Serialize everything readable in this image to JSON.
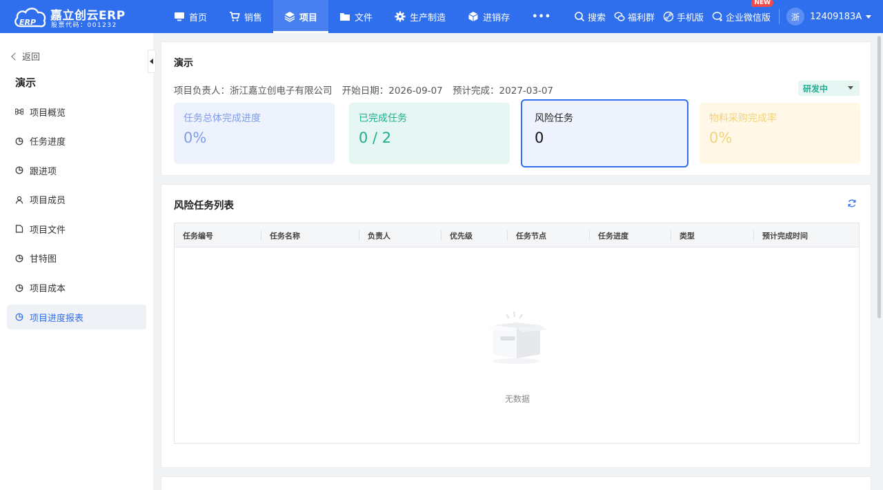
{
  "brand": {
    "title": "嘉立创云ERP",
    "subtitle": "股票代码：001232",
    "color": "#2f6fed"
  },
  "nav": {
    "items": [
      {
        "label": "首页",
        "icon": "monitor-icon"
      },
      {
        "label": "销售",
        "icon": "cart-icon"
      },
      {
        "label": "项目",
        "icon": "layers-icon",
        "active": true
      },
      {
        "label": "文件",
        "icon": "folder-icon"
      },
      {
        "label": "生产制造",
        "icon": "gear-icon"
      },
      {
        "label": "进销存",
        "icon": "box-icon"
      }
    ],
    "more": "•••"
  },
  "tools": {
    "search": "搜索",
    "benefit_group": "福利群",
    "mobile": "手机版",
    "wechat_work": "企业微信版",
    "new_badge": "NEW"
  },
  "user": {
    "avatar": "浙",
    "name": "12409183A"
  },
  "sidebar": {
    "back": "返回",
    "title": "演示",
    "items": [
      {
        "label": "项目概览",
        "icon": "command-icon"
      },
      {
        "label": "任务进度",
        "icon": "pie-icon"
      },
      {
        "label": "跟进项",
        "icon": "pie-icon"
      },
      {
        "label": "项目成员",
        "icon": "user-icon"
      },
      {
        "label": "项目文件",
        "icon": "file-icon"
      },
      {
        "label": "甘特图",
        "icon": "pie-icon"
      },
      {
        "label": "项目成本",
        "icon": "pie-icon"
      },
      {
        "label": "项目进度报表",
        "icon": "pie-icon",
        "active": true
      }
    ]
  },
  "project": {
    "name": "演示",
    "owner": "项目负责人：浙江嘉立创电子有限公司",
    "start": "开始日期：2026-09-07",
    "finish": "预计完成：2027-03-07",
    "status": "研发中",
    "status_color": "#1fae8d"
  },
  "stats": [
    {
      "label": "任务总体完成进度",
      "value": "0%"
    },
    {
      "label": "已完成任务",
      "value": "0 / 2"
    },
    {
      "label": "风险任务",
      "value": "0"
    },
    {
      "label": "物料采购完成率",
      "value": "0%"
    }
  ],
  "risk_table": {
    "title": "风险任务列表",
    "columns": [
      "任务编号",
      "任务名称",
      "负责人",
      "优先级",
      "任务节点",
      "任务进度",
      "类型",
      "预计完成时间"
    ],
    "rows": [],
    "empty_text": "无数据"
  }
}
